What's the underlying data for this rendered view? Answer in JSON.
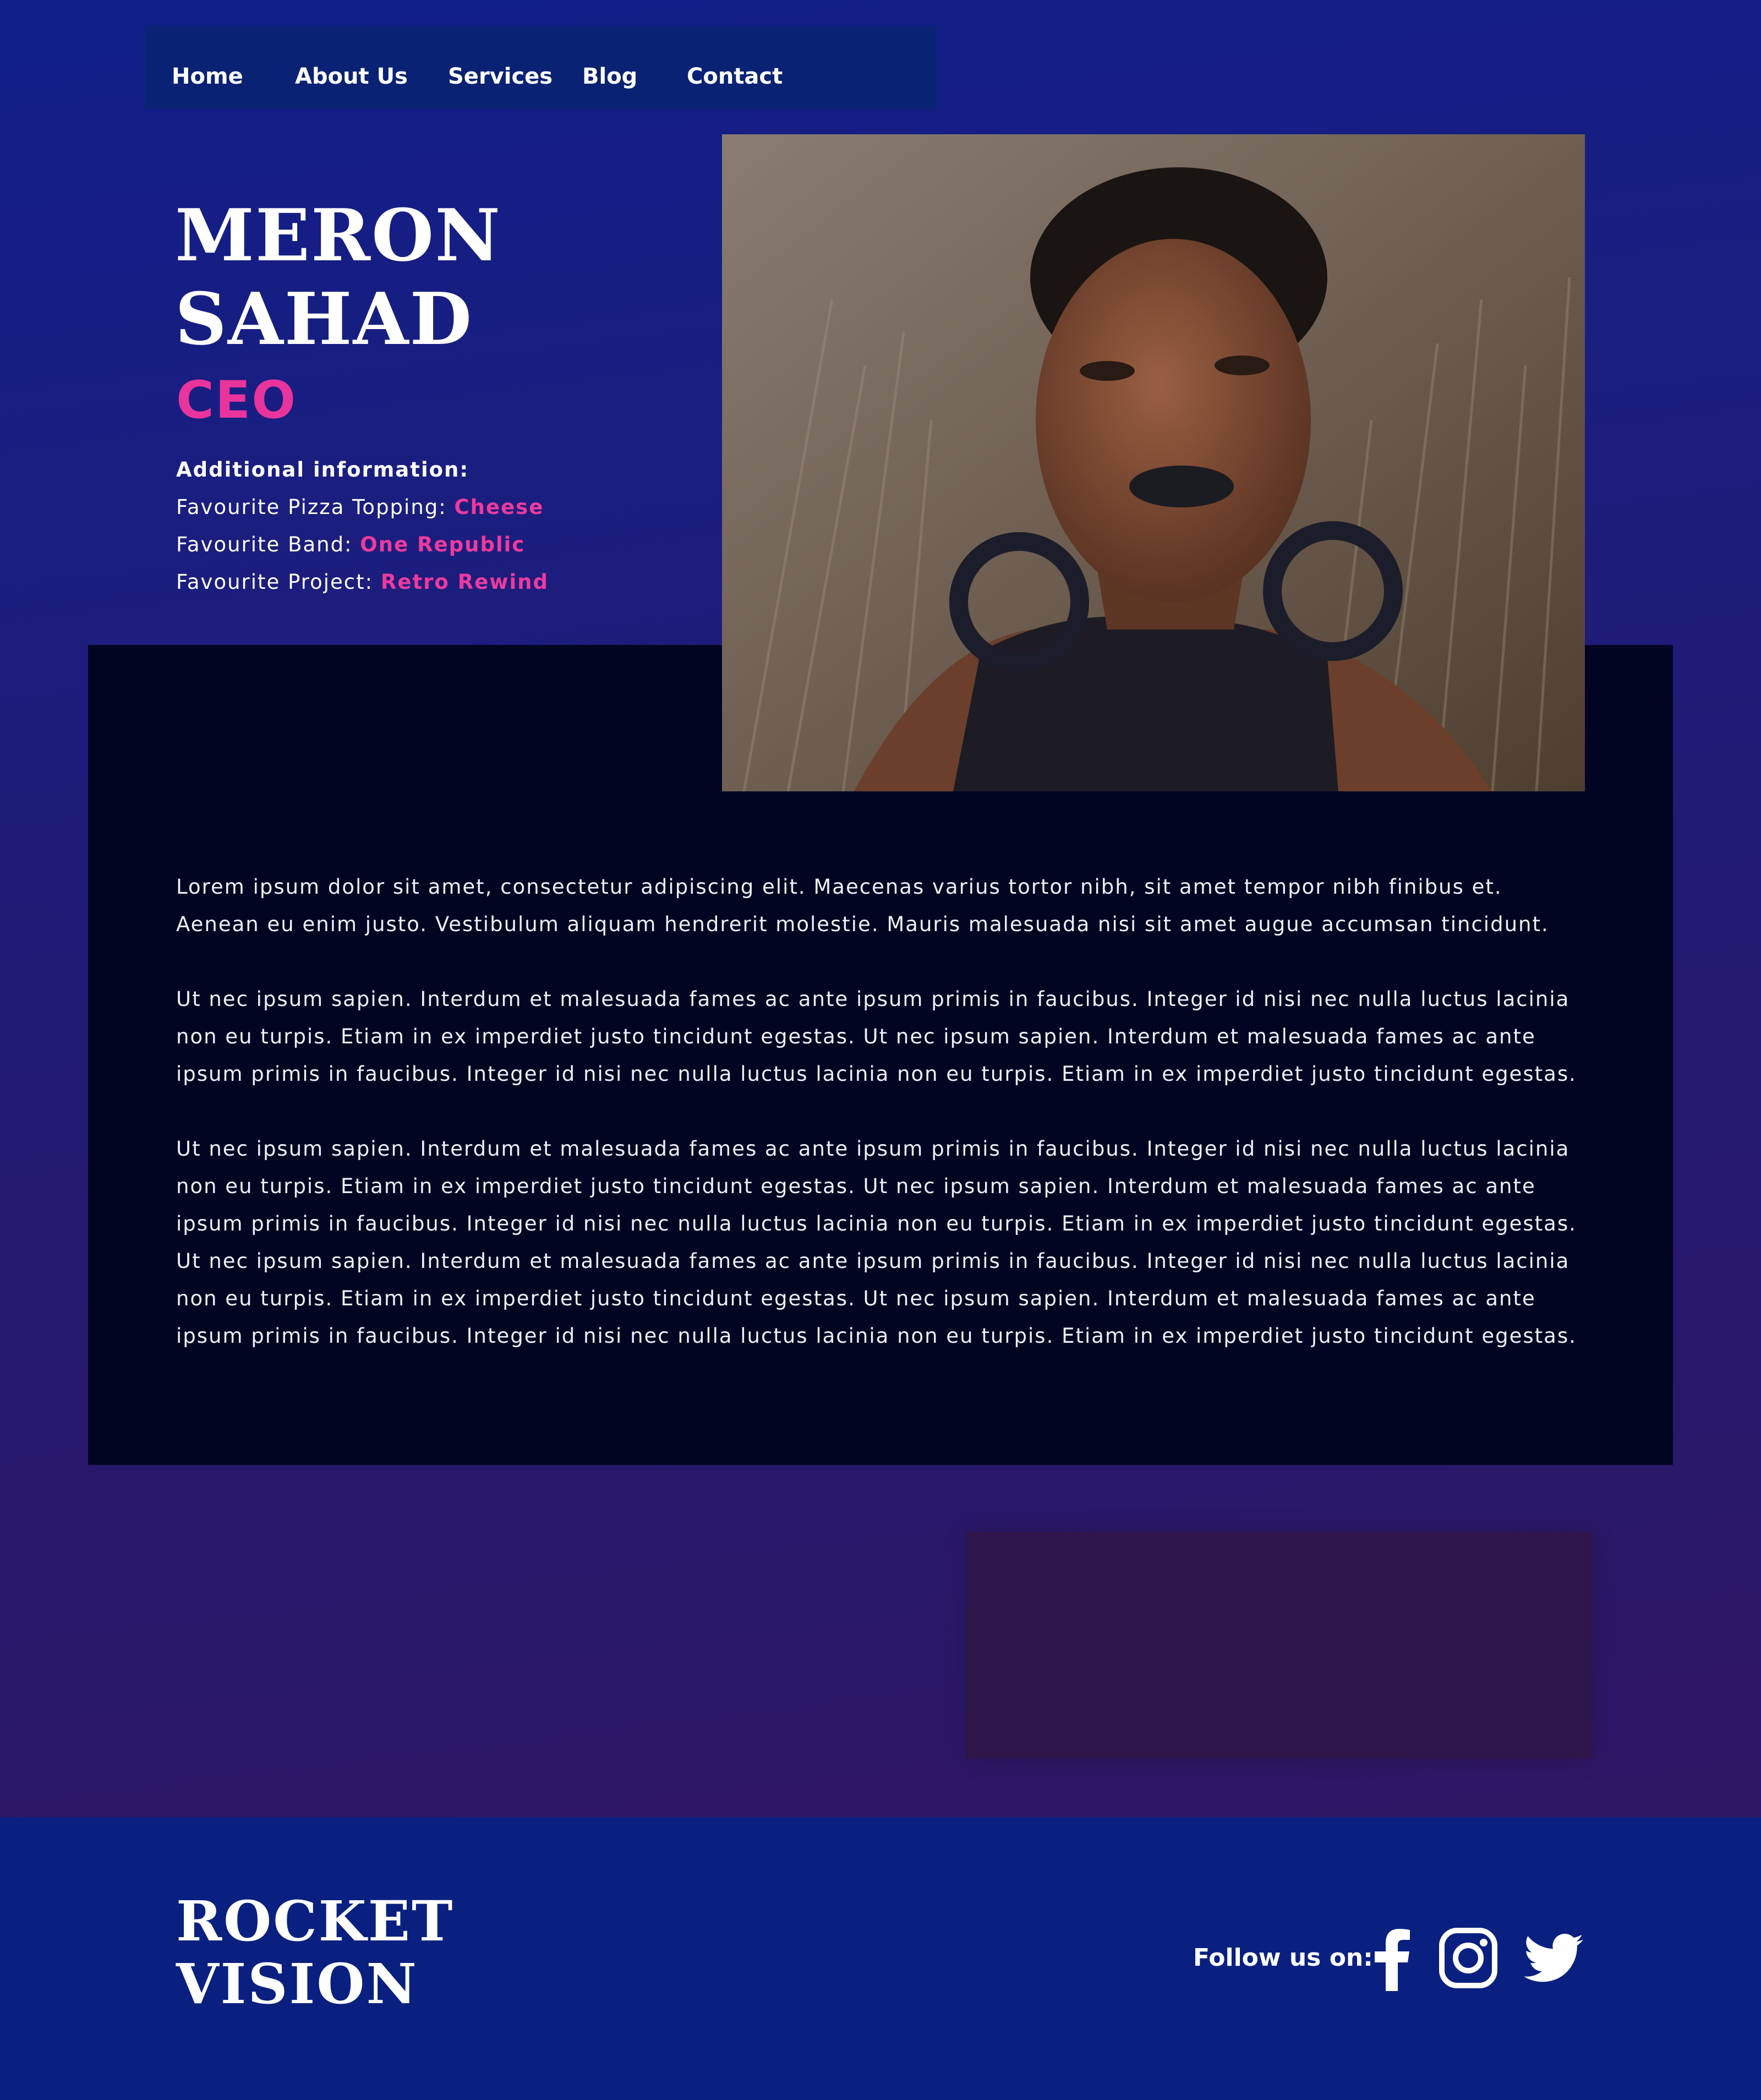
{
  "nav": {
    "items": [
      {
        "label": "Home"
      },
      {
        "label": "About Us"
      },
      {
        "label": "Services"
      },
      {
        "label": "Blog"
      },
      {
        "label": "Contact"
      }
    ]
  },
  "profile": {
    "first_name": "MERON",
    "last_name": "SAHAD",
    "role": "CEO",
    "info_heading": "Additional information:",
    "fields": [
      {
        "label": "Favourite Pizza Topping: ",
        "value": "Cheese"
      },
      {
        "label": "Favourite Band: ",
        "value": "One Republic"
      },
      {
        "label": "Favourite Project:  ",
        "value": "Retro Rewind"
      }
    ]
  },
  "bio": {
    "paragraphs": [
      "Lorem ipsum dolor sit amet, consectetur adipiscing elit. Maecenas varius tortor nibh, sit amet tempor nibh finibus et. Aenean eu enim justo. Vestibulum aliquam hendrerit molestie. Mauris malesuada nisi sit amet augue accumsan tincidunt.",
      " Ut nec ipsum sapien. Interdum et malesuada fames ac ante ipsum primis in faucibus. Integer id nisi nec nulla luctus lacinia non eu turpis. Etiam in ex imperdiet justo tincidunt egestas.  Ut nec ipsum sapien. Interdum et malesuada fames ac ante ipsum primis in faucibus. Integer id nisi nec nulla luctus lacinia non eu turpis. Etiam in ex imperdiet justo tincidunt egestas.",
      " Ut nec ipsum sapien. Interdum et malesuada fames ac ante ipsum primis in faucibus. Integer id nisi nec nulla luctus lacinia non eu turpis. Etiam in ex imperdiet justo tincidunt egestas.  Ut nec ipsum sapien. Interdum et malesuada fames ac ante ipsum primis in faucibus. Integer id nisi nec nulla luctus lacinia non eu turpis. Etiam in ex imperdiet justo tincidunt egestas.  Ut nec ipsum sapien. Interdum et malesuada fames ac ante ipsum primis in faucibus. Integer id nisi nec nulla luctus lacinia non eu turpis. Etiam in ex imperdiet justo tincidunt egestas.  Ut nec ipsum sapien. Interdum et malesuada fames ac ante ipsum primis in faucibus. Integer id nisi nec nulla luctus lacinia non eu turpis. Etiam in ex imperdiet justo tincidunt egestas."
    ]
  },
  "footer": {
    "brand_line1": "ROCKET",
    "brand_line2": "VISION",
    "follow_label": "Follow us on:",
    "social": [
      "facebook-icon",
      "instagram-icon",
      "twitter-icon"
    ]
  },
  "colors": {
    "accent_pink": "#e8349c",
    "nav_bg": "#0a2274",
    "panel_bg": "#020522",
    "footer_bg": "#0a2080"
  }
}
